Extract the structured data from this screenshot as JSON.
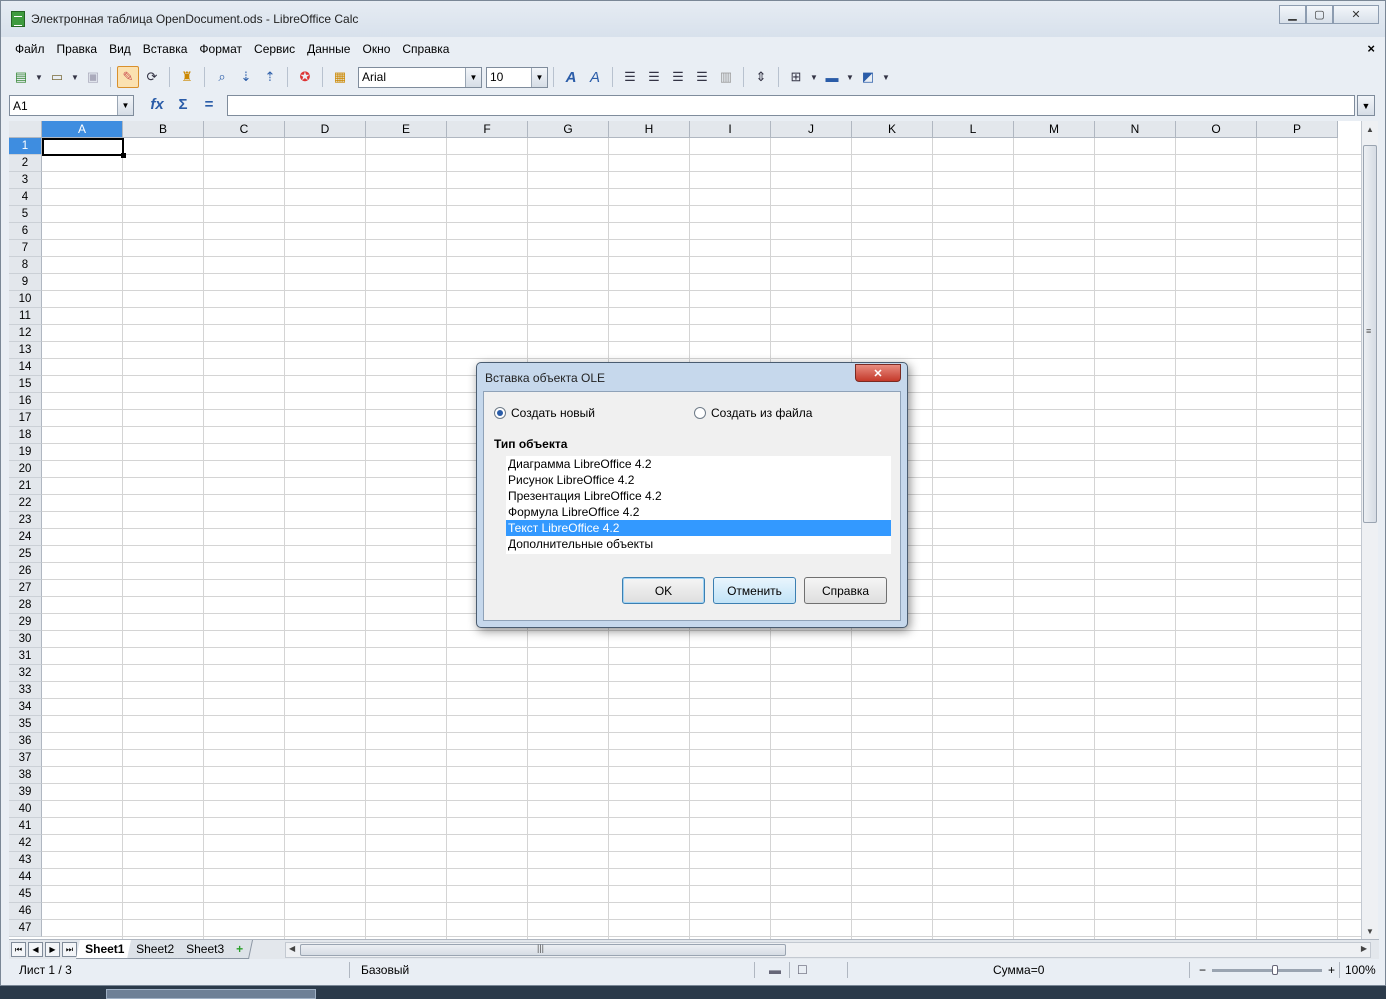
{
  "window": {
    "title": "Электронная таблица OpenDocument.ods - LibreOffice Calc",
    "minimize": "▁",
    "maximize": "▢",
    "close": "✕"
  },
  "menubar": {
    "items": [
      "Файл",
      "Правка",
      "Вид",
      "Вставка",
      "Формат",
      "Сервис",
      "Данные",
      "Окно",
      "Справка"
    ],
    "close": "×"
  },
  "toolbar": {
    "font_name": "Arial",
    "font_size": "10",
    "icons": [
      "new-icon",
      "open-icon",
      "save-icon",
      "edit-file-icon",
      "reload-icon",
      "clone-formatting-icon",
      "find-replace-icon",
      "sort-ascending-icon",
      "sort-descending-icon",
      "help-icon",
      "styles-icon",
      "bold-italic-a-icon",
      "italic-a-icon",
      "align-left-icon",
      "align-center-icon",
      "align-right-icon",
      "justify-icon",
      "merge-cells-icon",
      "wrap-icon",
      "borders-icon",
      "background-color-icon",
      "font-color-icon"
    ]
  },
  "formula_bar": {
    "name_box": "A1",
    "input_value": ""
  },
  "sheet": {
    "columns": [
      "A",
      "B",
      "C",
      "D",
      "E",
      "F",
      "G",
      "H",
      "I",
      "J",
      "K",
      "L",
      "M",
      "N",
      "O",
      "P"
    ],
    "rows": [
      "1",
      "2",
      "3",
      "4",
      "5",
      "6",
      "7",
      "8",
      "9",
      "10",
      "11",
      "12",
      "13",
      "14",
      "15",
      "16",
      "17",
      "18",
      "19",
      "20",
      "21",
      "22",
      "23",
      "24",
      "25",
      "26",
      "27",
      "28",
      "29",
      "30",
      "31",
      "32",
      "33",
      "34",
      "35",
      "36",
      "37",
      "38",
      "39",
      "40",
      "41",
      "42",
      "43",
      "44",
      "45",
      "46",
      "47"
    ],
    "active_column": "A",
    "active_row": "1"
  },
  "tabs": {
    "items": [
      "Sheet1",
      "Sheet2",
      "Sheet3"
    ],
    "active": "Sheet1",
    "add": "+"
  },
  "statusbar": {
    "sheet_info": "Лист 1 / 3",
    "style": "Базовый",
    "sum": "Сумма=0",
    "zoom": "100%",
    "zoom_minus": "−",
    "zoom_plus": "+"
  },
  "dialog": {
    "title": "Вставка объекта OLE",
    "close": "✕",
    "radio_new": "Создать новый",
    "radio_file": "Создать из файла",
    "object_type_label": "Тип объекта",
    "object_types": [
      "Диаграмма LibreOffice 4.2",
      "Рисунок LibreOffice 4.2",
      "Презентация LibreOffice 4.2",
      "Формула LibreOffice 4.2",
      "Текст LibreOffice 4.2",
      "Дополнительные объекты"
    ],
    "selected_index": 4,
    "ok": "OK",
    "cancel": "Отменить",
    "help": "Справка"
  },
  "colors": {
    "accent": "#3e8de0",
    "selection": "#3399ff"
  }
}
